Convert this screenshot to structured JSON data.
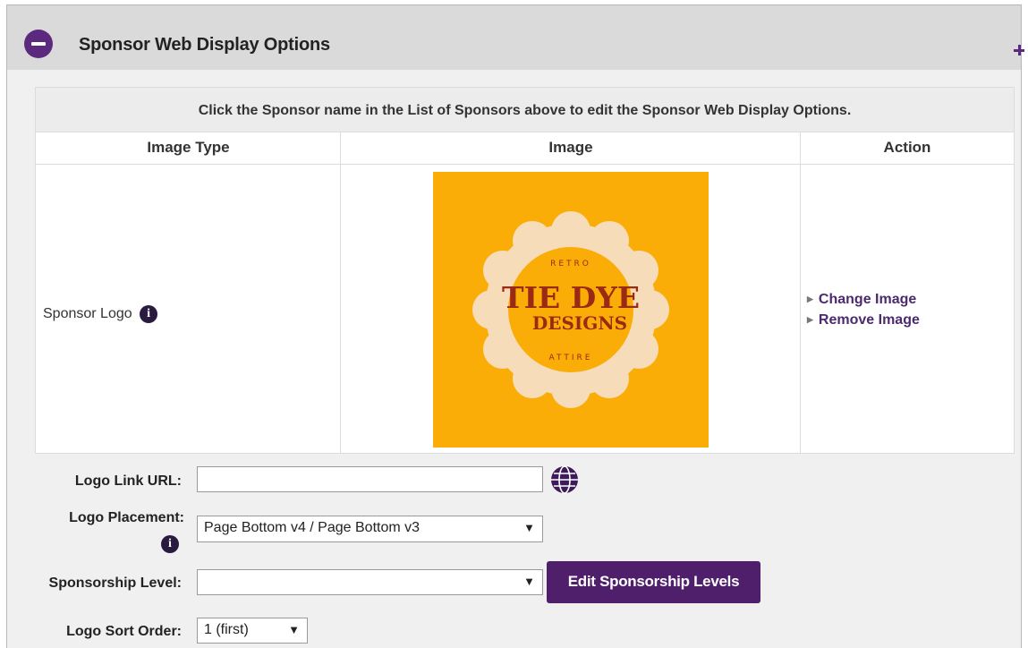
{
  "panel": {
    "title": "Sponsor Web Display Options"
  },
  "table": {
    "notice": "Click the Sponsor name in the List of Sponsors above to edit the Sponsor Web Display Options.",
    "headers": [
      "Image Type",
      "Image",
      "Action"
    ],
    "row": {
      "image_type": "Sponsor Logo",
      "logo": {
        "top_text": "RETRO",
        "main_text": "TIE DYE",
        "sub_text": "DESIGNS",
        "bottom_text": "ATTIRE"
      },
      "actions": [
        "Change Image",
        "Remove Image"
      ]
    }
  },
  "form": {
    "logo_link_label": "Logo Link URL:",
    "logo_link_value": "",
    "logo_placement_label": "Logo Placement:",
    "logo_placement_value": "Page Bottom v4 / Page Bottom v3",
    "sponsorship_level_label": "Sponsorship Level:",
    "sponsorship_level_value": "",
    "edit_levels_button": "Edit Sponsorship Levels",
    "sort_order_label": "Logo Sort Order:",
    "sort_order_value": "1 (first)"
  },
  "colors": {
    "brand_purple": "#4f1f6b",
    "logo_background": "#fbad07",
    "logo_flower": "#f6dcb8",
    "logo_text": "#9a2a14"
  }
}
